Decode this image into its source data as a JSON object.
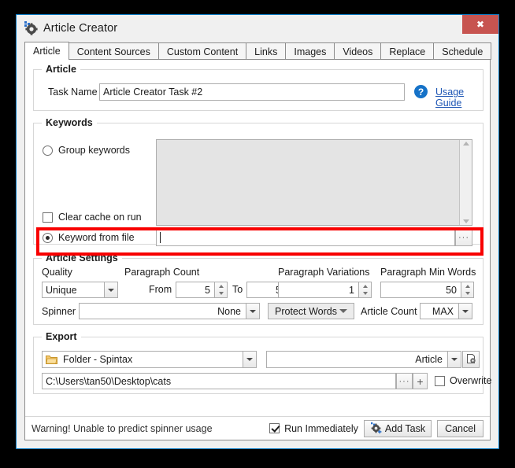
{
  "window": {
    "title": "Article Creator",
    "icon": "gear-icon",
    "close_label": "✖"
  },
  "tabs": [
    {
      "label": "Article",
      "active": true
    },
    {
      "label": "Content Sources",
      "active": false
    },
    {
      "label": "Custom Content",
      "active": false
    },
    {
      "label": "Links",
      "active": false
    },
    {
      "label": "Images",
      "active": false
    },
    {
      "label": "Videos",
      "active": false
    },
    {
      "label": "Replace",
      "active": false
    },
    {
      "label": "Schedule",
      "active": false
    }
  ],
  "article_group": {
    "title": "Article",
    "task_name_label": "Task Name",
    "task_name_value": "Article Creator Task #2",
    "help_icon": "?",
    "usage_guide_link": "Usage Guide"
  },
  "keywords_group": {
    "title": "Keywords",
    "group_keywords_label": "Group keywords",
    "group_keywords_selected": false,
    "clear_cache_label": "Clear cache on run",
    "clear_cache_checked": false,
    "keywords_text": "",
    "keyword_from_file_label": "Keyword from file",
    "keyword_from_file_selected": true,
    "keyword_file_value": "",
    "browse_button_label": "···",
    "highlight_color": "#f80000"
  },
  "article_settings": {
    "title": "Article Settings",
    "quality_label": "Quality",
    "quality_value": "Unique",
    "paragraph_count_label": "Paragraph Count",
    "from_label": "From",
    "from_value": "5",
    "to_label": "To",
    "to_value": "5",
    "paragraph_variations_label": "Paragraph Variations",
    "paragraph_variations_value": "1",
    "paragraph_min_words_label": "Paragraph Min Words",
    "paragraph_min_words_value": "50",
    "spinner_label": "Spinner",
    "spinner_value": "None",
    "protect_words_label": "Protect Words",
    "article_count_label": "Article Count",
    "article_count_value": "MAX"
  },
  "export_group": {
    "title": "Export",
    "format_value": "Folder - Spintax",
    "format_icon": "folder-icon",
    "type_value": "Article",
    "settings_icon": "page-gear-icon",
    "path_value": "C:\\Users\\tan50\\Desktop\\cats",
    "path_browse_label": "···",
    "path_add_label": "+",
    "overwrite_label": "Overwrite",
    "overwrite_checked": false
  },
  "statusbar": {
    "warning_text": "Warning! Unable to predict spinner usage",
    "run_immediately_label": "Run Immediately",
    "run_immediately_checked": true,
    "add_task_label": "Add Task",
    "add_task_icon": "gear-plus-icon",
    "cancel_label": "Cancel"
  }
}
